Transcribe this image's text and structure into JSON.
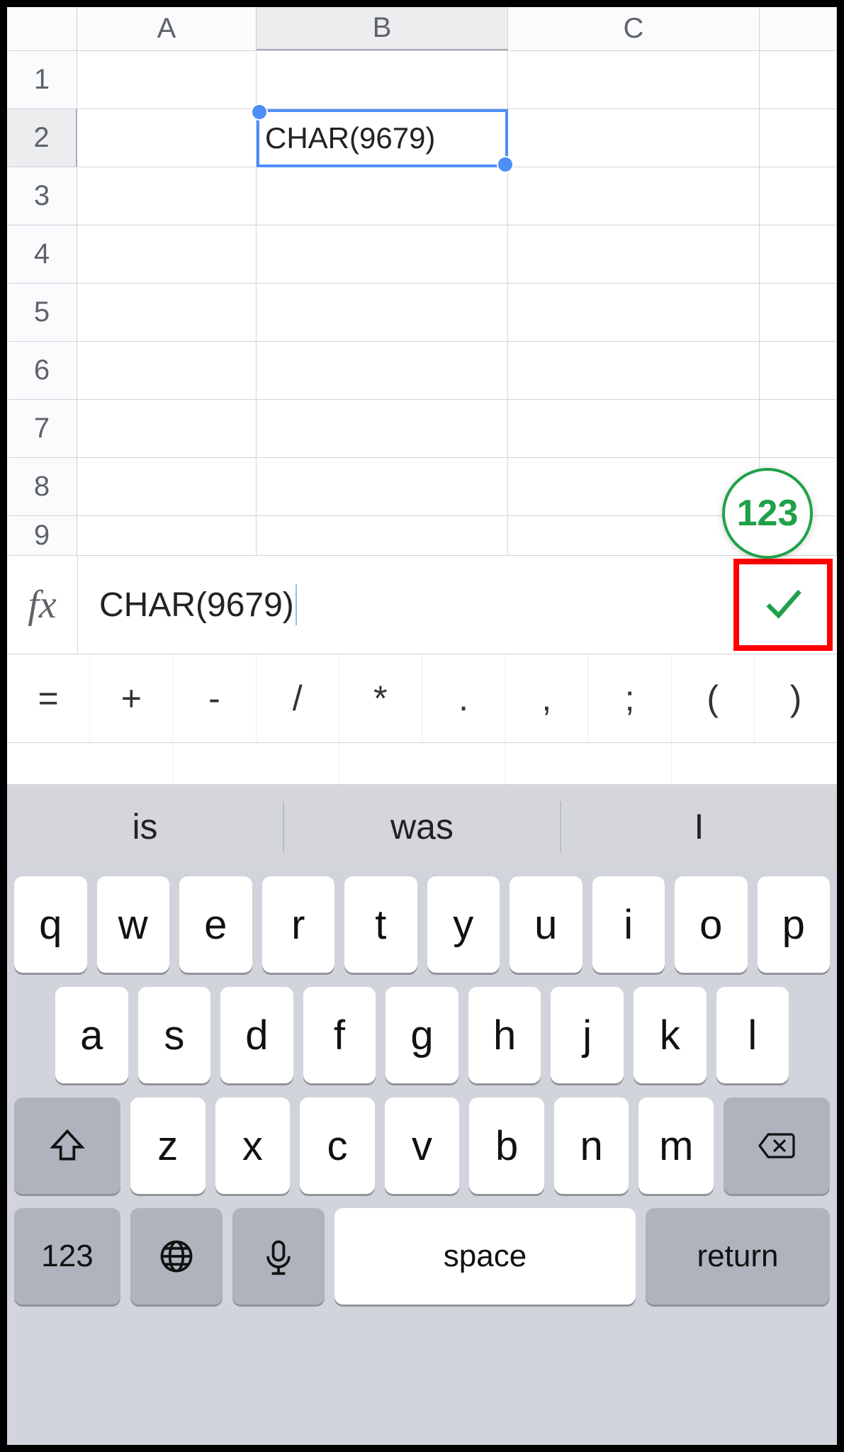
{
  "spreadsheet": {
    "columns": [
      "A",
      "B",
      "C"
    ],
    "rows": [
      "1",
      "2",
      "3",
      "4",
      "5",
      "6",
      "7",
      "8",
      "9"
    ],
    "selected_cell": "B2",
    "cell_value": "CHAR(9679)"
  },
  "num_toggle": {
    "label": "123"
  },
  "formula_bar": {
    "fx_label": "fx",
    "value": "CHAR(9679)"
  },
  "ops": [
    "=",
    "+",
    "-",
    "/",
    "*",
    ".",
    ",",
    ";",
    "(",
    ")"
  ],
  "keyboard": {
    "suggestions": [
      "is",
      "was",
      "I"
    ],
    "row1": [
      "q",
      "w",
      "e",
      "r",
      "t",
      "y",
      "u",
      "i",
      "o",
      "p"
    ],
    "row2": [
      "a",
      "s",
      "d",
      "f",
      "g",
      "h",
      "j",
      "k",
      "l"
    ],
    "row3": [
      "z",
      "x",
      "c",
      "v",
      "b",
      "n",
      "m"
    ],
    "numkey": "123",
    "space": "space",
    "return": "return"
  }
}
